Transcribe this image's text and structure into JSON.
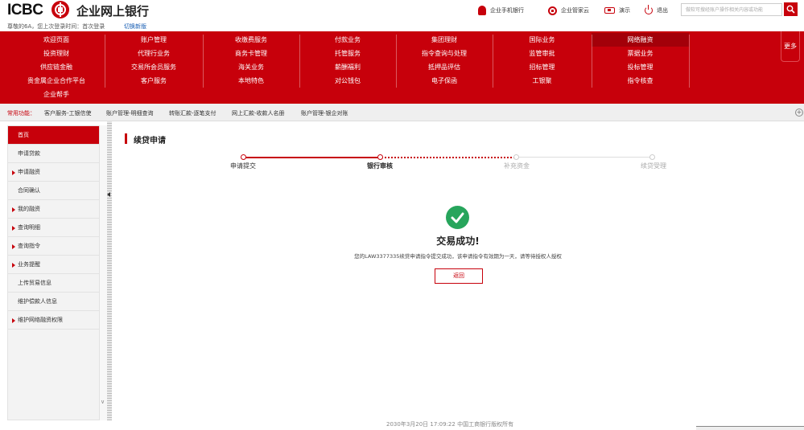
{
  "header": {
    "logo_text": "ICBC",
    "bank_name": "企业网上银行",
    "login_info": "尊敬的6A，您上次登录时间：首次登录",
    "switch_label": "切换新版",
    "top_links": [
      {
        "label": "企业手机银行",
        "icon": "mobile-icon"
      },
      {
        "label": "企业管家云",
        "icon": "gear-icon"
      },
      {
        "label": "演示",
        "icon": "demo-icon"
      },
      {
        "label": "退出",
        "icon": "power-icon"
      }
    ],
    "search_placeholder": "做软可搜经账户操作相关内容或功能"
  },
  "menu": {
    "rows": [
      [
        "欢迎页面",
        "账户管理",
        "收缴费服务",
        "付款业务",
        "集团理财",
        "国际业务",
        "网络融资"
      ],
      [
        "投资理财",
        "代理行业务",
        "商务卡管理",
        "托管服务",
        "指令查询与处理",
        "监管审批",
        "票据业务"
      ],
      [
        "供应链金融",
        "交易所会员服务",
        "海关业务",
        "薪酬福利",
        "抵押品评估",
        "招标管理",
        "投标管理"
      ],
      [
        "贵金属企业合作平台",
        "客户服务",
        "本地特色",
        "对公钱包",
        "电子保函",
        "工银聚",
        "指令核查"
      ],
      [
        "企业帮手"
      ]
    ],
    "more_label": "更多"
  },
  "quick": {
    "label": "常用功能：",
    "items": [
      "客户服务-工银信使",
      "账户管理-明细查询",
      "转账汇款-逐笔支付",
      "网上汇款-收款人名册",
      "账户管理-银企对账"
    ]
  },
  "sidebar": {
    "items": [
      {
        "label": "首页",
        "active": true,
        "tri": false
      },
      {
        "label": "申请贷款",
        "active": false,
        "tri": false
      },
      {
        "label": "申请融资",
        "active": false,
        "tri": true
      },
      {
        "label": "合同确认",
        "active": false,
        "tri": false
      },
      {
        "label": "我的融资",
        "active": false,
        "tri": true
      },
      {
        "label": "查询明细",
        "active": false,
        "tri": true
      },
      {
        "label": "查询指令",
        "active": false,
        "tri": true
      },
      {
        "label": "业务提醒",
        "active": false,
        "tri": true
      },
      {
        "label": "上传贸易信息",
        "active": false,
        "tri": false
      },
      {
        "label": "维护偿款人信息",
        "active": false,
        "tri": false
      },
      {
        "label": "维护网络融资权限",
        "active": false,
        "tri": true
      }
    ]
  },
  "main": {
    "title": "续贷申请",
    "steps": [
      "申请提交",
      "银行审核",
      "补充资金",
      "续贷受理"
    ],
    "success_title": "交易成功!",
    "success_msg": "您的LAW3377335续贷申请指令提交成功，该申请指令有效期为一天，请等待授权人授权",
    "return_label": "返回"
  },
  "footer": {
    "text": "2030年3月20日 17:09:22    中国工商银行版权所有"
  },
  "colors": {
    "brand": "#c7000b",
    "success": "#27a55c"
  }
}
